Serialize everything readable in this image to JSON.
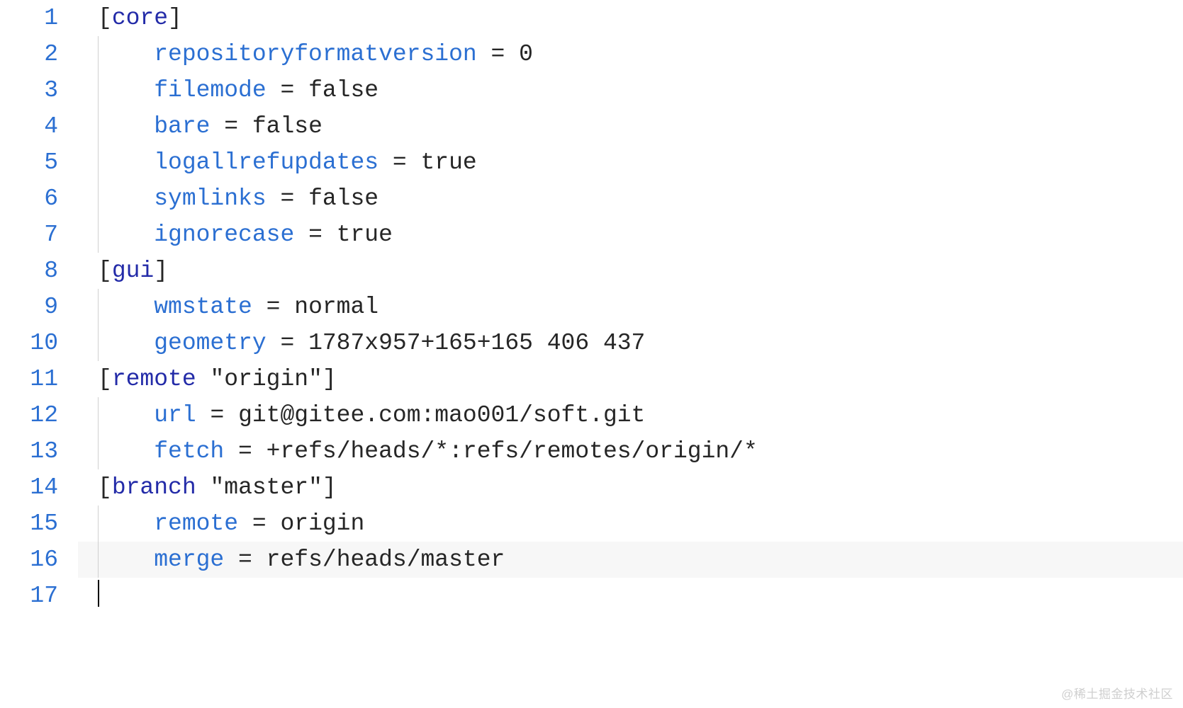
{
  "watermark": "@稀土掘金技术社区",
  "lines": {
    "l1": {
      "num": "1",
      "bracket_open": "[",
      "section": "core",
      "bracket_close": "]"
    },
    "l2": {
      "num": "2",
      "key": "repositoryformatversion",
      "eq": " = ",
      "val": "0"
    },
    "l3": {
      "num": "3",
      "key": "filemode",
      "eq": " = ",
      "val": "false"
    },
    "l4": {
      "num": "4",
      "key": "bare",
      "eq": " = ",
      "val": "false"
    },
    "l5": {
      "num": "5",
      "key": "logallrefupdates",
      "eq": " = ",
      "val": "true"
    },
    "l6": {
      "num": "6",
      "key": "symlinks",
      "eq": " = ",
      "val": "false"
    },
    "l7": {
      "num": "7",
      "key": "ignorecase",
      "eq": " = ",
      "val": "true"
    },
    "l8": {
      "num": "8",
      "bracket_open": "[",
      "section": "gui",
      "bracket_close": "]"
    },
    "l9": {
      "num": "9",
      "key": "wmstate",
      "eq": " = ",
      "val": "normal"
    },
    "l10": {
      "num": "10",
      "key": "geometry",
      "eq": " = ",
      "val": "1787x957+165+165 406 437"
    },
    "l11": {
      "num": "11",
      "bracket_open": "[",
      "section": "remote",
      "space": " ",
      "quote_open": "\"",
      "name": "origin",
      "quote_close": "\"",
      "bracket_close": "]"
    },
    "l12": {
      "num": "12",
      "key": "url",
      "eq": " = ",
      "val": "git@gitee.com:mao001/soft.git"
    },
    "l13": {
      "num": "13",
      "key": "fetch",
      "eq": " = ",
      "val": "+refs/heads/*:refs/remotes/origin/*"
    },
    "l14": {
      "num": "14",
      "bracket_open": "[",
      "section": "branch",
      "space": " ",
      "quote_open": "\"",
      "name": "master",
      "quote_close": "\"",
      "bracket_close": "]"
    },
    "l15": {
      "num": "15",
      "key": "remote",
      "eq": " = ",
      "val": "origin"
    },
    "l16": {
      "num": "16",
      "key": "merge",
      "eq": " = ",
      "val": "refs/heads/master"
    },
    "l17": {
      "num": "17"
    }
  }
}
